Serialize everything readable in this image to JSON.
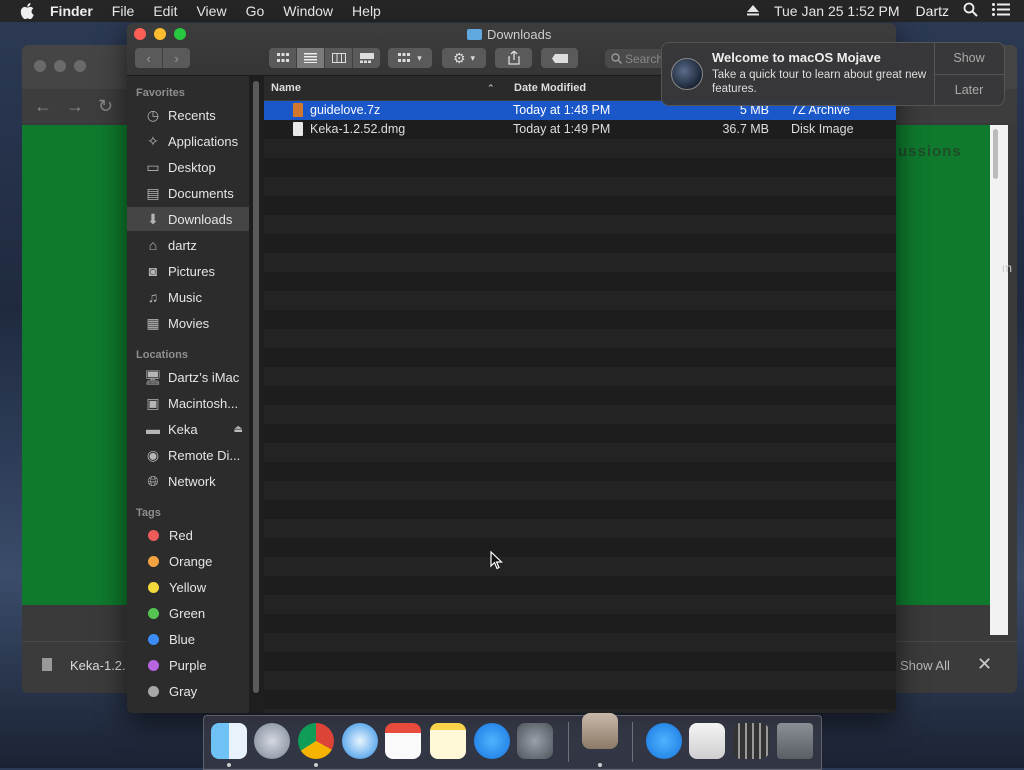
{
  "menubar": {
    "app_name": "Finder",
    "menus": [
      "File",
      "Edit",
      "View",
      "Go",
      "Window",
      "Help"
    ],
    "clock": "Tue Jan 25  1:52 PM",
    "user": "Dartz"
  },
  "window": {
    "title": "Downloads",
    "search_placeholder": "Search"
  },
  "sidebar": {
    "favorites_header": "Favorites",
    "favorites": [
      {
        "label": "Recents",
        "icon": "recents-icon"
      },
      {
        "label": "Applications",
        "icon": "applications-icon"
      },
      {
        "label": "Desktop",
        "icon": "desktop-icon"
      },
      {
        "label": "Documents",
        "icon": "documents-icon"
      },
      {
        "label": "Downloads",
        "icon": "downloads-icon"
      },
      {
        "label": "dartz",
        "icon": "home-icon"
      },
      {
        "label": "Pictures",
        "icon": "pictures-icon"
      },
      {
        "label": "Music",
        "icon": "music-icon"
      },
      {
        "label": "Movies",
        "icon": "movies-icon"
      }
    ],
    "locations_header": "Locations",
    "locations": [
      {
        "label": "Dartz’s iMac",
        "icon": "imac-icon"
      },
      {
        "label": "Macintosh...",
        "icon": "hard-disk-icon"
      },
      {
        "label": "Keka",
        "icon": "disk-image-icon"
      },
      {
        "label": "Remote Di...",
        "icon": "remote-disc-icon"
      },
      {
        "label": "Network",
        "icon": "network-icon"
      }
    ],
    "tags_header": "Tags",
    "tags": [
      {
        "label": "Red",
        "color": "#ec5a5a"
      },
      {
        "label": "Orange",
        "color": "#f5a340"
      },
      {
        "label": "Yellow",
        "color": "#f2d83c"
      },
      {
        "label": "Green",
        "color": "#55c453"
      },
      {
        "label": "Blue",
        "color": "#3b8cf5"
      },
      {
        "label": "Purple",
        "color": "#b865e0"
      },
      {
        "label": "Gray",
        "color": "#a8a8a8"
      }
    ]
  },
  "file_list": {
    "columns": {
      "name": "Name",
      "date": "Date Modified"
    },
    "rows": [
      {
        "name": "guidelove.7z",
        "date": "Today at 1:48 PM",
        "size": "5 MB",
        "kind": "7Z Archive",
        "selected": true
      },
      {
        "name": "Keka-1.2.52.dmg",
        "date": "Today at 1:49 PM",
        "size": "36.7 MB",
        "kind": "Disk Image",
        "selected": false
      }
    ]
  },
  "notification": {
    "title": "Welcome to macOS Mojave",
    "body": "Take a quick tour to learn about great new features.",
    "show_button": "Show",
    "later_button": "Later"
  },
  "browser": {
    "page_heading_fragment": "ussions",
    "page_letter": "m",
    "download_item": "Keka-1.2.",
    "show_all": "Show All"
  },
  "colors": {
    "selection_blue": "#1a57c9",
    "browser_page_green": "#0f7a2e"
  }
}
